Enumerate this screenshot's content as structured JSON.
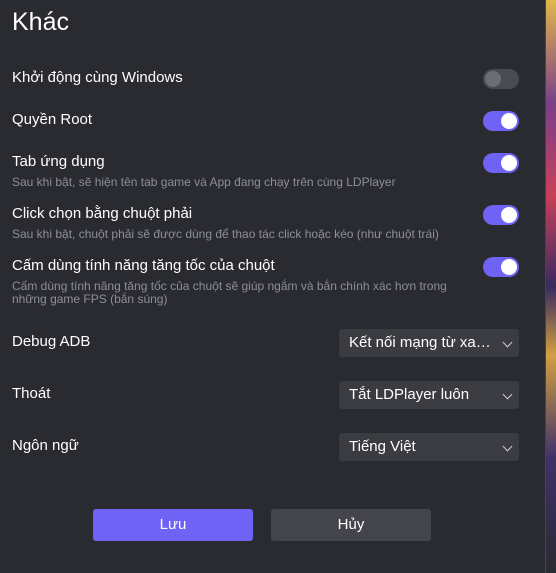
{
  "title": "Khác",
  "settings": {
    "startup": {
      "label": "Khởi động cùng Windows",
      "enabled": false
    },
    "root": {
      "label": "Quyền Root",
      "enabled": true
    },
    "app_tab": {
      "label": "Tab ứng dụng",
      "desc": "Sau khi bật, sẽ hiện tên tab game và App đang chạy trên cùng LDPlayer",
      "enabled": true
    },
    "right_click": {
      "label": "Click chọn bằng chuột phải",
      "desc": "Sau khi bật, chuột phải sẽ được dùng để thao tác click hoặc kéo (như chuột trái)",
      "enabled": true
    },
    "mouse_accel": {
      "label": "Cấm dùng tính năng tăng tốc của chuột",
      "desc": "Cấm dùng tính năng tăng tốc của chuột sẽ giúp ngắm và bắn chính xác hơn trong những game FPS (bắn súng)",
      "enabled": true
    }
  },
  "selects": {
    "debug_adb": {
      "label": "Debug ADB",
      "value": "Kết nối mạng từ xa (kh..."
    },
    "exit": {
      "label": "Thoát",
      "value": "Tắt LDPlayer luôn"
    },
    "language": {
      "label": "Ngôn ngữ",
      "value": "Tiếng Việt"
    }
  },
  "buttons": {
    "save": "Lưu",
    "cancel": "Hủy"
  },
  "colors": {
    "accent": "#6e63f4",
    "background": "#2a2b31",
    "toggle_off": "#4a4b52",
    "description": "#8e8f96"
  }
}
